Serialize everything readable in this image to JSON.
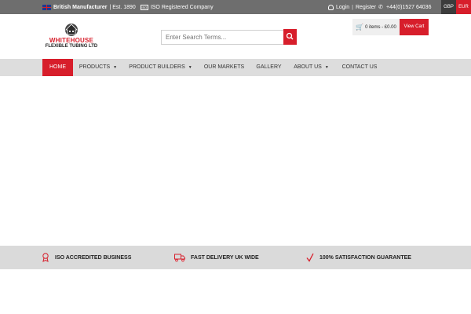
{
  "topbar": {
    "british_manufacturer": "British Manufacturer",
    "established": "| Est. 1890",
    "iso_registered": "ISO Registered Company",
    "login": "Login",
    "register": "Register",
    "phone": "+44(0)1527 64036",
    "currency_gbp": "GBP",
    "currency_eur": "EUR"
  },
  "header": {
    "logo_line1": "WHITEHOUSE",
    "logo_line2": "FLEXIBLE TUBING LTD",
    "search_placeholder": "Enter Search Terms...",
    "cart_summary": "0 items - £0.00",
    "view_cart": "View Cart"
  },
  "nav": {
    "items": [
      {
        "label": "HOME"
      },
      {
        "label": "PRODUCTS"
      },
      {
        "label": "PRODUCT BUILDERS"
      },
      {
        "label": "OUR MARKETS"
      },
      {
        "label": "GALLERY"
      },
      {
        "label": "ABOUT US"
      },
      {
        "label": "CONTACT US"
      }
    ]
  },
  "features": [
    {
      "label": "ISO ACCREDITED BUSINESS",
      "icon": "award-ribbon-icon"
    },
    {
      "label": "FAST DELIVERY UK WIDE",
      "icon": "delivery-truck-icon"
    },
    {
      "label": "100% SATISFACTION GUARANTEE",
      "icon": "checkmark-icon"
    }
  ],
  "colors": {
    "accent": "#d71e2b",
    "topbar": "#6e6e6e",
    "nav_bg": "#dddddd",
    "features_bg": "#dadada"
  }
}
